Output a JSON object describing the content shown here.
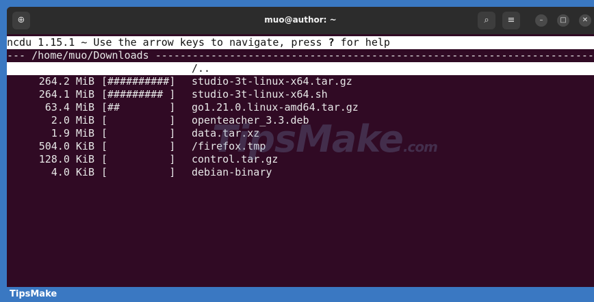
{
  "window": {
    "title": "muo@author: ~",
    "new_tab_icon": "new-tab-icon",
    "search_icon": "search-icon",
    "menu_icon": "hamburger-menu-icon",
    "minimize_icon": "minimize-icon",
    "maximize_icon": "maximize-icon",
    "close_icon": "close-icon"
  },
  "terminal": {
    "header_prefix": "ncdu 1.15.1 ~ Use the arrow keys to navigate, press ",
    "header_key": "?",
    "header_suffix": " for help",
    "path_line": "--- /home/muo/Downloads --------------------------------------------------------------------------------------------",
    "parent_dir": "/..",
    "entries": [
      {
        "size": "264.2 MiB",
        "bar": "[##########]",
        "name": "studio-3t-linux-x64.tar.gz"
      },
      {
        "size": "264.1 MiB",
        "bar": "[######### ]",
        "name": "studio-3t-linux-x64.sh"
      },
      {
        "size": "63.4 MiB",
        "bar": "[##        ]",
        "name": "go1.21.0.linux-amd64.tar.gz"
      },
      {
        "size": "2.0 MiB",
        "bar": "[          ]",
        "name": "openteacher_3.3.deb"
      },
      {
        "size": "1.9 MiB",
        "bar": "[          ]",
        "name": "data.tar.xz"
      },
      {
        "size": "504.0 KiB",
        "bar": "[          ]",
        "name": "/firefox.tmp"
      },
      {
        "size": "128.0 KiB",
        "bar": "[          ]",
        "name": "control.tar.gz"
      },
      {
        "size": "4.0 KiB",
        "bar": "[          ]",
        "name": "debian-binary"
      }
    ]
  },
  "watermark": {
    "main": "TipsMake",
    "suffix": ".com"
  },
  "footer": {
    "label": "TipsMake"
  },
  "colors": {
    "terminal_bg": "#300a24",
    "titlebar_bg": "#2c2c2c",
    "footer_bg": "#3a78c2"
  }
}
